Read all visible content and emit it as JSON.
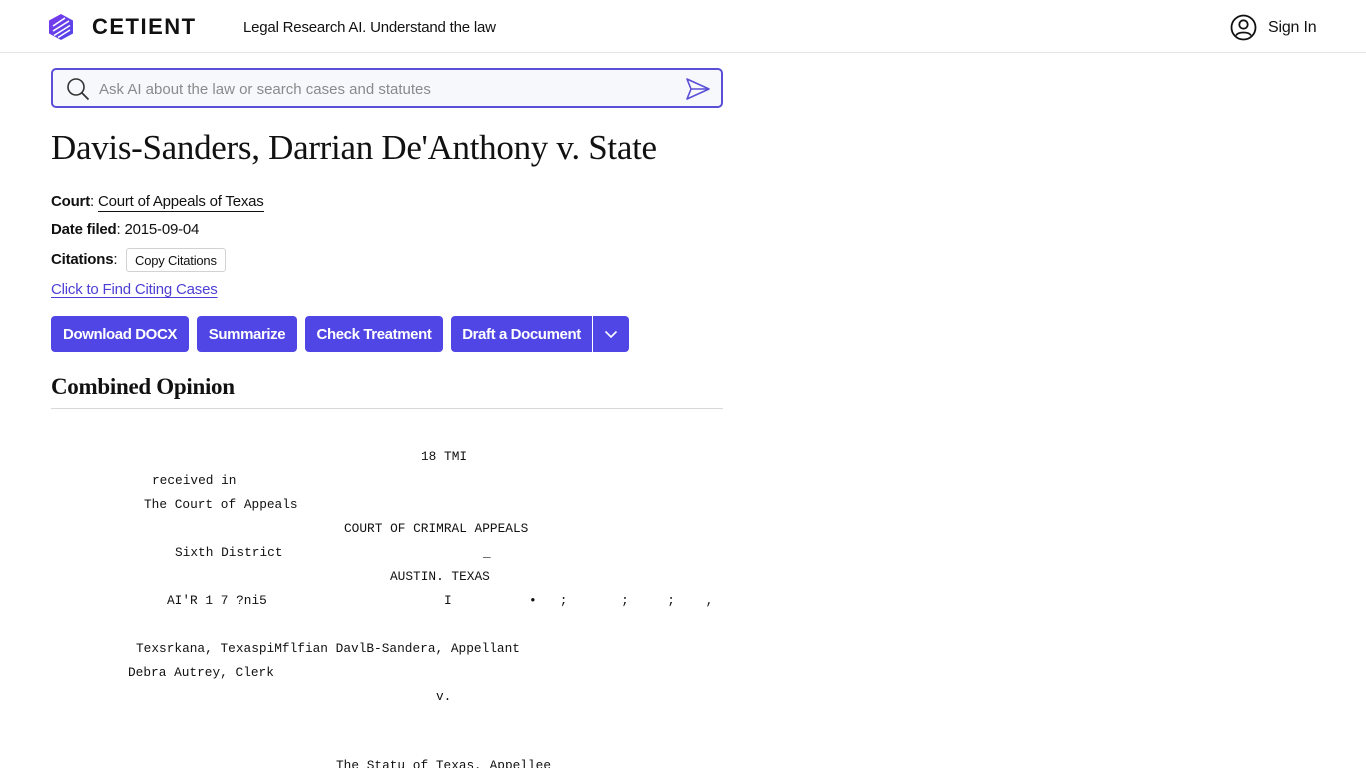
{
  "header": {
    "brand": "CETIENT",
    "tagline": "Legal Research AI. Understand the law",
    "signin_label": "Sign In"
  },
  "search": {
    "placeholder": "Ask AI about the law or search cases and statutes"
  },
  "case": {
    "title": "Davis-Sanders, Darrian De'Anthony v. State",
    "court_label": "Court",
    "court_value": "Court of Appeals of Texas",
    "date_label": "Date filed",
    "date_value": "2015-09-04",
    "citations_label": "Citations",
    "copy_citations_label": "Copy Citations",
    "citing_link": "Click to Find Citing Cases"
  },
  "actions": {
    "download": "Download DOCX",
    "summarize": "Summarize",
    "check_treatment": "Check Treatment",
    "draft": "Draft a Document"
  },
  "opinion": {
    "section_title": "Combined Opinion",
    "lines": [
      "18 TMI",
      "received in",
      "The Court of Appeals",
      "COURT OF CRIMRAL APPEALS",
      "Sixth District",
      "_",
      "AUSTIN. TEXAS",
      "AI'R 1 7 ?ni5",
      "I",
      "•   ;       ;     ;    ,",
      "Texsrkana, TexaspiMflfian DavlB-Sandera, Appellant",
      "Debra Autrey, Clerk",
      "v.",
      "The Statu of Texas, Appellee"
    ]
  },
  "colors": {
    "accent": "#5046e5",
    "link": "#4d3fd4",
    "search_border": "#5a4fd6"
  }
}
